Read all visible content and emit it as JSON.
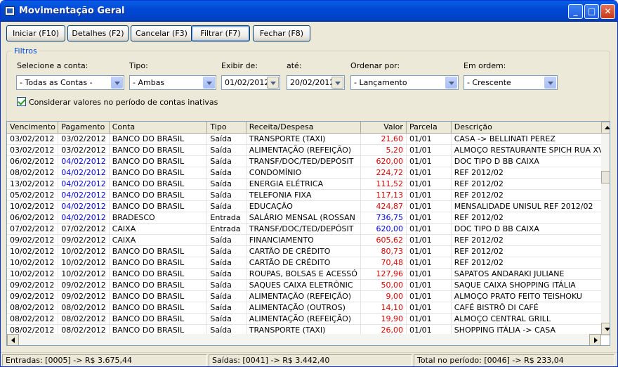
{
  "window": {
    "title": "Movimentação Geral"
  },
  "toolbar": {
    "iniciar": "Iniciar (F10)",
    "detalhes": "Detalhes (F2)",
    "cancelar": "Cancelar (F3)",
    "filtrar": "Filtrar (F7)",
    "fechar": "Fechar (F8)"
  },
  "filters": {
    "title": "Filtros",
    "conta_label": "Selecione a conta:",
    "conta_value": "- Todas as Contas -",
    "tipo_label": "Tipo:",
    "tipo_value": "- Ambas",
    "exibir_label": "Exibir de:",
    "exibir_value": "01/02/2012",
    "ate_label": "até:",
    "ate_value": "20/02/2012",
    "ordenar_label": "Ordenar por:",
    "ordenar_value": "- Lançamento",
    "ordem_label": "Em ordem:",
    "ordem_value": "- Crescente",
    "checkbox_label": "Considerar valores no período de contas inativas",
    "checkbox_checked": true
  },
  "grid": {
    "columns": [
      "Vencimento",
      "Pagamento",
      "Conta",
      "Tipo",
      "Receita/Despesa",
      "Valor",
      "Parcela",
      "Descrição"
    ],
    "rows": [
      {
        "venc": "03/02/2012",
        "pag": "03/02/2012",
        "pag_color": "black",
        "conta": "BANCO DO BRASIL",
        "tipo": "Saída",
        "rd": "TRANSPORTE (TAXI)",
        "valor": "21,60",
        "valor_color": "red",
        "parcela": "01/01",
        "desc": "CASA -> BELLINATI PEREZ"
      },
      {
        "venc": "03/02/2012",
        "pag": "03/02/2012",
        "pag_color": "black",
        "conta": "BANCO DO BRASIL",
        "tipo": "Saída",
        "rd": "ALIMENTAÇÃO (REFEIÇÃO)",
        "valor": "5,20",
        "valor_color": "red",
        "parcela": "01/01",
        "desc": "ALMOÇO RESTAURANTE SPICH RUA XV"
      },
      {
        "venc": "06/02/2012",
        "pag": "04/02/2012",
        "pag_color": "blue",
        "conta": "BANCO DO BRASIL",
        "tipo": "Saída",
        "rd": "TRANSF/DOC/TED/DEPÓSIT",
        "valor": "620,00",
        "valor_color": "red",
        "parcela": "01/01",
        "desc": "DOC TIPO D BB CAIXA"
      },
      {
        "venc": "08/02/2012",
        "pag": "04/02/2012",
        "pag_color": "blue",
        "conta": "BANCO DO BRASIL",
        "tipo": "Saída",
        "rd": "CONDOMÍNIO",
        "valor": "224,72",
        "valor_color": "red",
        "parcela": "01/01",
        "desc": "REF 2012/02"
      },
      {
        "venc": "13/02/2012",
        "pag": "04/02/2012",
        "pag_color": "blue",
        "conta": "BANCO DO BRASIL",
        "tipo": "Saída",
        "rd": "ENERGIA ELÉTRICA",
        "valor": "111,52",
        "valor_color": "red",
        "parcela": "01/01",
        "desc": "REF 2012/02"
      },
      {
        "venc": "05/02/2012",
        "pag": "04/02/2012",
        "pag_color": "blue",
        "conta": "BANCO DO BRASIL",
        "tipo": "Saída",
        "rd": "TELEFONIA FIXA",
        "valor": "117,13",
        "valor_color": "red",
        "parcela": "01/01",
        "desc": "REF 2012/02"
      },
      {
        "venc": "10/02/2012",
        "pag": "04/02/2012",
        "pag_color": "blue",
        "conta": "BANCO DO BRASIL",
        "tipo": "Saída",
        "rd": "EDUCAÇÃO",
        "valor": "424,87",
        "valor_color": "red",
        "parcela": "01/01",
        "desc": "MENSALIDADE UNISUL REF 2012/02"
      },
      {
        "venc": "06/02/2012",
        "pag": "04/02/2012",
        "pag_color": "blue",
        "conta": "BRADESCO",
        "tipo": "Entrada",
        "rd": "SALÁRIO MENSAL (ROSSAN",
        "valor": "736,75",
        "valor_color": "blue",
        "parcela": "01/01",
        "desc": "REF 2012/02"
      },
      {
        "venc": "07/02/2012",
        "pag": "07/02/2012",
        "pag_color": "black",
        "conta": "CAIXA",
        "tipo": "Entrada",
        "rd": "TRANSF/DOC/TED/DEPÓSIT",
        "valor": "620,00",
        "valor_color": "blue",
        "parcela": "01/01",
        "desc": "DOC TIPO D BB CAIXA"
      },
      {
        "venc": "09/02/2012",
        "pag": "09/02/2012",
        "pag_color": "black",
        "conta": "CAIXA",
        "tipo": "Saída",
        "rd": "FINANCIAMENTO",
        "valor": "605,62",
        "valor_color": "red",
        "parcela": "01/01",
        "desc": "REF 2012/02"
      },
      {
        "venc": "10/02/2012",
        "pag": "10/02/2012",
        "pag_color": "black",
        "conta": "BANCO DO BRASIL",
        "tipo": "Saída",
        "rd": "CARTÃO DE CRÉDITO",
        "valor": "80,73",
        "valor_color": "red",
        "parcela": "01/01",
        "desc": "REF 2012/02"
      },
      {
        "venc": "10/02/2012",
        "pag": "10/02/2012",
        "pag_color": "black",
        "conta": "BANCO DO BRASIL",
        "tipo": "Saída",
        "rd": "CARTÃO DE CRÉDITO",
        "valor": "70,48",
        "valor_color": "red",
        "parcela": "01/01",
        "desc": "REF 2012/02"
      },
      {
        "venc": "10/02/2012",
        "pag": "10/02/2012",
        "pag_color": "black",
        "conta": "BANCO DO BRASIL",
        "tipo": "Saída",
        "rd": "ROUPAS, BOLSAS E ACESSÓ",
        "valor": "127,96",
        "valor_color": "red",
        "parcela": "01/01",
        "desc": "SAPATOS ANDARAKI JULIANE"
      },
      {
        "venc": "09/02/2012",
        "pag": "09/02/2012",
        "pag_color": "black",
        "conta": "BANCO DO BRASIL",
        "tipo": "Saída",
        "rd": "SAQUES CAIXA ELETRÔNIC",
        "valor": "50,00",
        "valor_color": "red",
        "parcela": "01/01",
        "desc": "SAQUE CAIXA SHOPPING ITÁLIA"
      },
      {
        "venc": "09/02/2012",
        "pag": "09/02/2012",
        "pag_color": "black",
        "conta": "BANCO DO BRASIL",
        "tipo": "Saída",
        "rd": "ALIMENTAÇÃO (REFEIÇÃO)",
        "valor": "9,00",
        "valor_color": "red",
        "parcela": "01/01",
        "desc": "ALMOÇO PRATO FEITO TEISHOKU"
      },
      {
        "venc": "08/02/2012",
        "pag": "08/02/2012",
        "pag_color": "black",
        "conta": "BANCO DO BRASIL",
        "tipo": "Saída",
        "rd": "ALIMENTAÇÃO (OUTROS)",
        "valor": "14,10",
        "valor_color": "red",
        "parcela": "01/01",
        "desc": "CAFÉ BISTRÔ DI CAFÉ"
      },
      {
        "venc": "08/02/2012",
        "pag": "08/02/2012",
        "pag_color": "black",
        "conta": "BANCO DO BRASIL",
        "tipo": "Saída",
        "rd": "ALIMENTAÇÃO (REFEIÇÃO)",
        "valor": "19,90",
        "valor_color": "red",
        "parcela": "01/01",
        "desc": "ALMOÇO CENTRAL GRILL"
      },
      {
        "venc": "08/02/2012",
        "pag": "08/02/2012",
        "pag_color": "black",
        "conta": "BANCO DO BRASIL",
        "tipo": "Saída",
        "rd": "TRANSPORTE (TAXI)",
        "valor": "26,00",
        "valor_color": "red",
        "parcela": "01/01",
        "desc": "SHOPPING ITÁLIA -> CASA"
      }
    ]
  },
  "status": {
    "entradas": "Entradas: [0005] -> R$ 3.675,44",
    "saidas": "Saídas: [0041] -> R$ 3.442,40",
    "total": "Total no período: [0046] -> R$ 233,04"
  },
  "colors": {
    "red": "#e00000",
    "blue": "#0000e0",
    "black": "#000000",
    "title_blue": "#0048d6"
  }
}
